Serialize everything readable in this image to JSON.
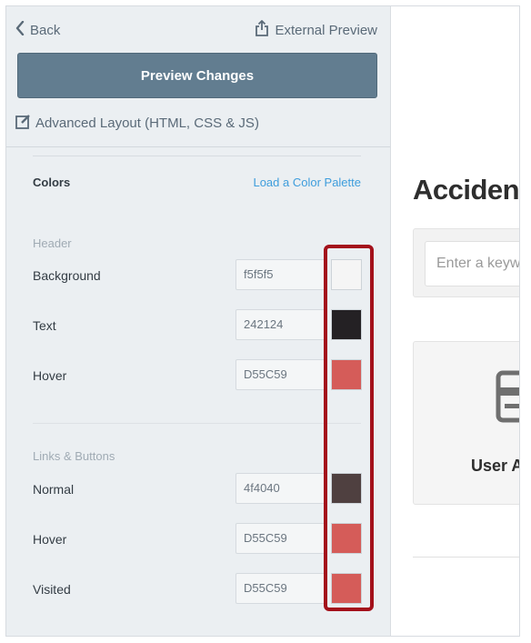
{
  "nav": {
    "back_label": "Back",
    "external_preview_label": "External Preview",
    "preview_changes_label": "Preview Changes",
    "advanced_layout_label": "Advanced Layout (HTML, CSS & JS)"
  },
  "colors": {
    "title": "Colors",
    "load_palette_label": "Load a Color Palette",
    "header_section": {
      "label": "Header",
      "rows": [
        {
          "label": "Background",
          "value": "f5f5f5",
          "swatch": "#f5f5f5"
        },
        {
          "label": "Text",
          "value": "242124",
          "swatch": "#242124"
        },
        {
          "label": "Hover",
          "value": "D55C59",
          "swatch": "#D55C59"
        }
      ]
    },
    "links_section": {
      "label": "Links & Buttons",
      "rows": [
        {
          "label": "Normal",
          "value": "4f4040",
          "swatch": "#4f4040"
        },
        {
          "label": "Hover",
          "value": "D55C59",
          "swatch": "#D55C59"
        },
        {
          "label": "Visited",
          "value": "D55C59",
          "swatch": "#D55C59"
        }
      ]
    },
    "highlight_color": "#a3111b"
  },
  "preview": {
    "title": "Acciden",
    "search_placeholder": "Enter a keyw",
    "card_label": "User A"
  },
  "theme": {
    "sidebar_bg": "#ebeff2",
    "button_bg": "#627d90",
    "link_color": "#3e9ddc"
  }
}
